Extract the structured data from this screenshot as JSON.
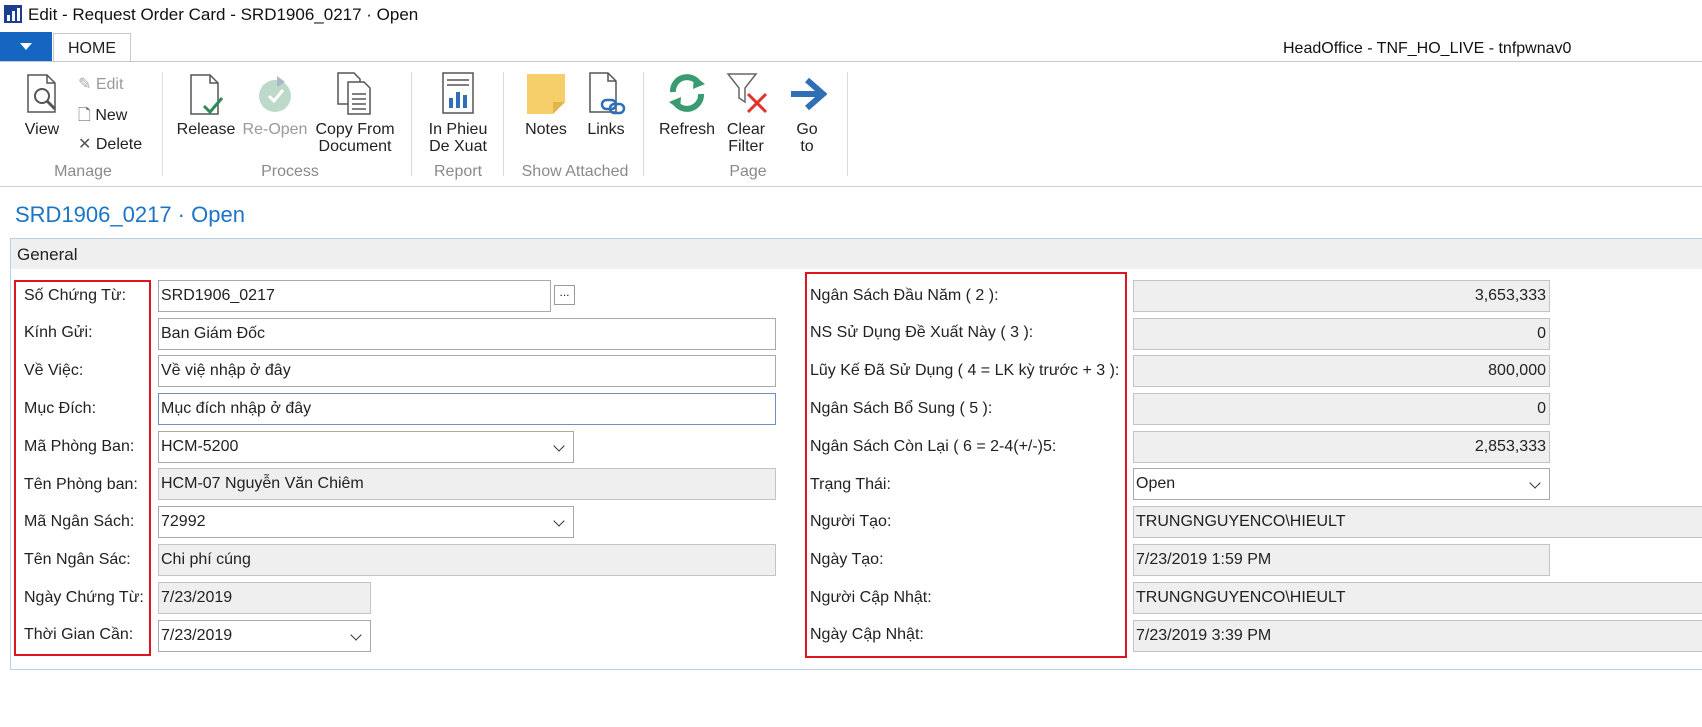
{
  "window": {
    "title": "Edit - Request Order Card - SRD1906_0217 · Open"
  },
  "tabs": {
    "home": "HOME"
  },
  "session": "HeadOffice - TNF_HO_LIVE - tnfpwnav0",
  "ribbon": {
    "manage": {
      "group": "Manage",
      "view": "View",
      "edit": "Edit",
      "new": "New",
      "delete": "Delete"
    },
    "process": {
      "group": "Process",
      "release": "Release",
      "reopen": "Re-Open",
      "copy_line1": "Copy From",
      "copy_line2": "Document"
    },
    "report": {
      "group": "Report",
      "in_phieu_line1": "In Phieu",
      "in_phieu_line2": "De Xuat"
    },
    "show_attached": {
      "group": "Show Attached",
      "notes": "Notes",
      "links": "Links"
    },
    "page": {
      "group": "Page",
      "refresh": "Refresh",
      "clear_line1": "Clear",
      "clear_line2": "Filter",
      "goto_line1": "Go",
      "goto_line2": "to"
    }
  },
  "page_title": "SRD1906_0217 · Open",
  "general": {
    "header": "General",
    "left": [
      {
        "label": "Số Chứng Từ:",
        "value": "SRD1906_0217"
      },
      {
        "label": "Kính Gửi:",
        "value": "Ban Giám Đốc"
      },
      {
        "label": "Về Việc:",
        "value": "Về việ nhập ở đây"
      },
      {
        "label": "Mục Đích:",
        "value": "Mục đích nhập ở đây"
      },
      {
        "label": "Mã Phòng Ban:",
        "value": "HCM-5200"
      },
      {
        "label": "Tên Phòng ban:",
        "value": "HCM-07 Nguyễn Văn Chiêm"
      },
      {
        "label": "Mã Ngân Sách:",
        "value": "72992"
      },
      {
        "label": "Tên Ngân Sác:",
        "value": "Chi phí cúng"
      },
      {
        "label": "Ngày Chứng Từ:",
        "value": "7/23/2019"
      },
      {
        "label": "Thời Gian Cần:",
        "value": "7/23/2019"
      }
    ],
    "right": [
      {
        "label": "Ngân Sách Đầu Năm ( 2 ):",
        "value": "3,653,333"
      },
      {
        "label": "NS Sử Dụng Đề Xuất Này ( 3 ):",
        "value": "0"
      },
      {
        "label": "Lũy Kế Đã Sử Dụng ( 4 = LK kỳ trước + 3 ):",
        "value": "800,000"
      },
      {
        "label": "Ngân Sách Bổ Sung ( 5 ):",
        "value": "0"
      },
      {
        "label": "Ngân Sách Còn Lại ( 6 = 2-4(+/-)5:",
        "value": "2,853,333"
      },
      {
        "label": "Trạng Thái:",
        "value": "Open"
      },
      {
        "label": "Người Tạo:",
        "value": "TRUNGNGUYENCO\\HIEULT"
      },
      {
        "label": "Ngày Tạo:",
        "value": "7/23/2019 1:59 PM"
      },
      {
        "label": "Người Cập Nhật:",
        "value": "TRUNGNGUYENCO\\HIEULT"
      },
      {
        "label": "Ngày Cập Nhật:",
        "value": "7/23/2019 3:39 PM"
      }
    ],
    "lookup_button": "..."
  },
  "colors": {
    "accent": "#1b74c5",
    "highlight": "#e0141e",
    "app_button": "#1466c0"
  }
}
